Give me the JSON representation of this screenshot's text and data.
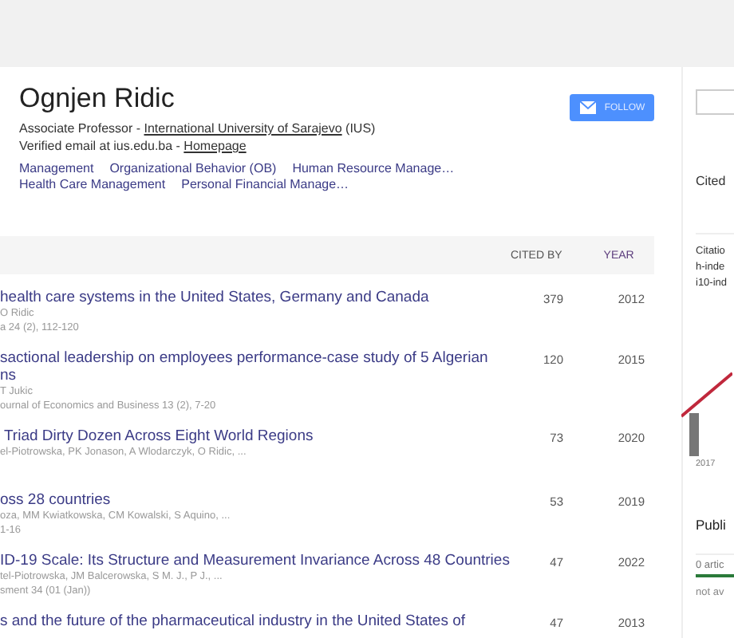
{
  "profile": {
    "name": "Ognjen Ridic",
    "position": "Associate Professor - ",
    "affiliation": "International University of Sarajevo",
    "affiliation_suffix": " (IUS)",
    "email": "Verified email at ius.edu.ba - ",
    "homepage": "Homepage",
    "interests": [
      "Management",
      "Organizational Behavior (OB)",
      "Human Resource Manage…",
      "Health Care Management",
      "Personal Financial Manage…"
    ],
    "follow_button": "FOLLOW"
  },
  "table": {
    "columns": [
      "CITED BY",
      "YEAR"
    ],
    "rows": [
      {
        "title": "health care systems in the United States, Germany and Canada",
        "authors": "O Ridic",
        "venue": "a 24 (2), 112-120",
        "cited_by": "379",
        "year": "2012"
      },
      {
        "title": "sactional leadership on employees performance-case study of 5 Algerian\nns",
        "authors": "T Jukic",
        "venue": "ournal of Economics and Business 13 (2), 7-20",
        "cited_by": "120",
        "year": "2015"
      },
      {
        "title": " Triad Dirty Dozen Across Eight World Regions",
        "authors": "el-Piotrowska, PK Jonason, A Wlodarczyk, O Ridic, ...",
        "cited_by": "73",
        "year": "2020"
      },
      {
        "title": "oss 28 countries",
        "authors": "oza, MM Kwiatkowska, CM Kowalski, S Aquino, ...",
        "venue": "1-16",
        "cited_by": "53",
        "year": "2019"
      },
      {
        "title": "ID-19 Scale: Its Structure and Measurement Invariance Across 48 Countries",
        "authors": "tel-Piotrowska, JM Balcerowska, S M. J., P J., ...",
        "venue": "sment 34 (01 (Jan))",
        "cited_by": "47",
        "year": "2022"
      },
      {
        "title": "s and the future of the pharmaceutical industry in the United States of",
        "cited_by": "47",
        "year": "2013"
      }
    ]
  },
  "sidebar": {
    "cited_heading": "Cited",
    "metrics": [
      "Citatio",
      "h-inde",
      "i10-ind"
    ],
    "chart_label": "2017",
    "public_access": {
      "heading": "Publi",
      "count": "0 artic",
      "level": 1,
      "note": "not av"
    }
  }
}
